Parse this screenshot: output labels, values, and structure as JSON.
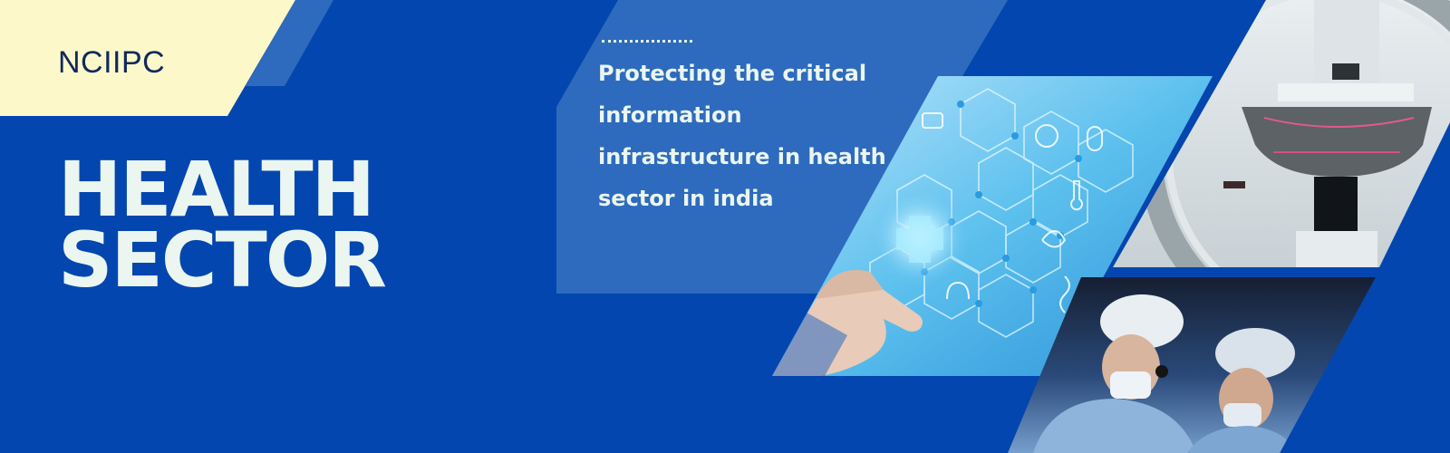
{
  "logo": {
    "text": "NCIIPC"
  },
  "headline": {
    "line1": "HEALTH",
    "line2": "SECTOR"
  },
  "tagline": {
    "text": "Protecting the critical information infrastructure in health sector in india"
  },
  "colors": {
    "background": "#0346AF",
    "accent_panel": "#2E6BBE",
    "logo_bg": "#FCF8C9",
    "headline_text": "#EAF6EF"
  },
  "images": [
    {
      "name": "medical-technology-photo",
      "depicts": "hand touching holographic medical icons"
    },
    {
      "name": "mri-scanner-photo",
      "depicts": "MRI scanner machine"
    },
    {
      "name": "surgeons-photo",
      "depicts": "surgeons in operating room"
    }
  ]
}
